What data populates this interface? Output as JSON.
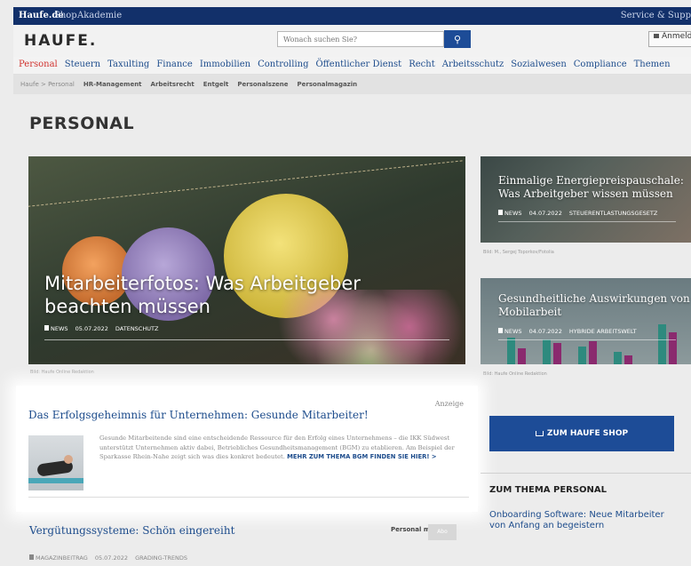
{
  "topbar": {
    "brand": "Haufe.de",
    "links": [
      "Shop",
      "Akademie"
    ],
    "service": "Service & Supp"
  },
  "header": {
    "logo": "HAUFE.",
    "search_placeholder": "Wonach suchen Sie?",
    "search_icon": "search-icon",
    "login_label": "Anmelde"
  },
  "main_nav": [
    "Personal",
    "Steuern",
    "Taxulting",
    "Finance",
    "Immobilien",
    "Controlling",
    "Öffentlicher Dienst",
    "Recht",
    "Arbeitsschutz",
    "Sozialwesen",
    "Compliance",
    "Themen"
  ],
  "sub_nav": {
    "breadcrumb": "Haufe > Personal",
    "items": [
      "HR-Management",
      "Arbeitsrecht",
      "Entgelt",
      "Personalszene",
      "Personalmagazin"
    ]
  },
  "page_title": "PERSONAL",
  "hero": {
    "title": "Mitarbeiterfotos: Was Arbeitgeber beachten müssen",
    "type": "NEWS",
    "date": "05.07.2022",
    "tag": "DATENSCHUTZ",
    "caption": "Bild: Haufe Online Redaktion"
  },
  "side_teasers": [
    {
      "title": "Einmalige Energiepreispauschale: Was Arbeitgeber wissen müssen",
      "type": "NEWS",
      "date": "04.07.2022",
      "tag": "STEUERENTLASTUNGSGESETZ",
      "caption": "Bild: M., Sergej Toporkov/Fotolia"
    },
    {
      "title": "Gesundheitliche Auswirkungen von Mobilarbeit",
      "type": "NEWS",
      "date": "04.07.2022",
      "tag": "HYBRIDE ARBEITSWELT",
      "caption": "Bild: Haufe Online Redaktion"
    }
  ],
  "ad": {
    "label": "Anzeige",
    "title": "Das Erfolgsgeheimnis für Unternehmen: Gesunde Mitarbeiter!",
    "text": "Gesunde Mitarbeitende sind eine entscheidende Ressource für den Erfolg eines Unternehmens – die IKK Südwest unterstützt Unternehmen aktiv dabei, Betriebliches Gesundheitsmanagement (BGM) zu etablieren. Am Beispiel der Sparkasse Rhein-Nahe zeigt sich was dies konkret bedeutet.",
    "link": "MEHR ZUM THEMA BGM FINDEN SIE HIER! >"
  },
  "article": {
    "title": "Vergütungssysteme: Schön eingereiht",
    "logo": "Personal magazin",
    "badge": "Abo",
    "type": "MAGAZINBEITRAG",
    "date": "05.07.2022",
    "tag": "GRADING-TRENDS"
  },
  "right_column": {
    "shop_button": "ZUM HAUFE SHOP",
    "heading": "ZUM THEMA PERSONAL",
    "link": "Onboarding Software: Neue Mitarbeiter von Anfang an begeistern"
  },
  "colors": {
    "topbar": "#12306a",
    "accent_blue": "#1d4c97",
    "active_nav": "#d0312d",
    "link": "#1d4c8c"
  }
}
